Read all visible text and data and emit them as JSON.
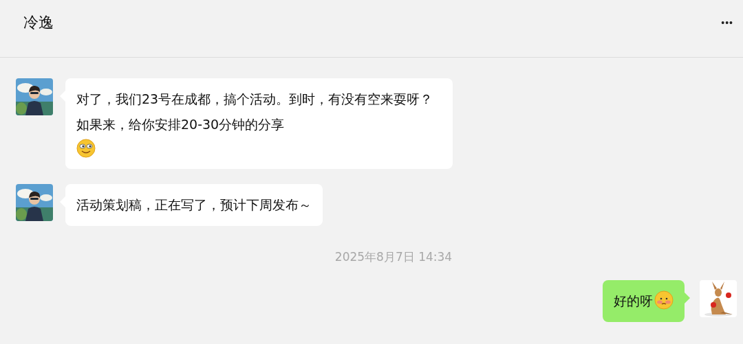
{
  "header": {
    "title": "冷逸",
    "menu": "•••"
  },
  "messages": [
    {
      "kind": "incoming",
      "text": "对了，我们23号在成都，搞个活动。到时，有没有空来耍呀？如果来，给你安排20-30分钟的分享",
      "emoji": true
    },
    {
      "kind": "incoming",
      "text": "活动策划稿，正在写了，预计下周发布～",
      "emoji": false
    },
    {
      "kind": "time",
      "text": "2025年8月7日 14:34"
    },
    {
      "kind": "outgoing",
      "text": "好的呀",
      "emoji": true
    }
  ]
}
